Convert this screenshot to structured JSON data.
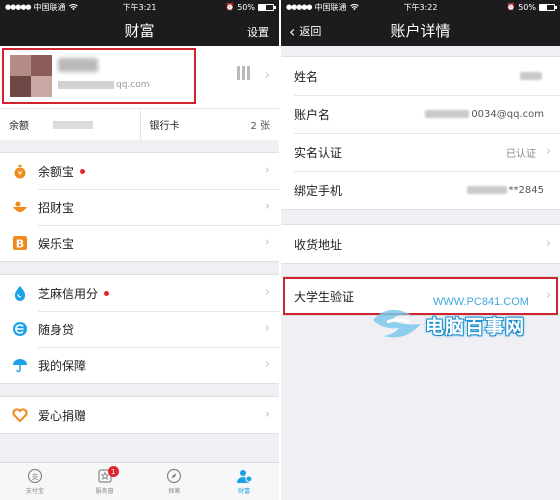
{
  "left": {
    "status": {
      "carrier": "中国联通",
      "time": "下午3:21",
      "battery": "50%",
      "battery_level": 0.5
    },
    "nav": {
      "title": "财富",
      "settings": "设置"
    },
    "profile": {
      "email_suffix": "qq.com"
    },
    "balance": {
      "label": "余额",
      "bank_label": "银行卡",
      "bank_count": "2 张"
    },
    "groups": [
      [
        {
          "label": "余额宝",
          "icon": "money-bag-icon",
          "dot": true
        },
        {
          "label": "招财宝",
          "icon": "fortune-bowl-icon",
          "dot": false
        },
        {
          "label": "娱乐宝",
          "icon": "b-logo-icon",
          "dot": false
        }
      ],
      [
        {
          "label": "芝麻信用分",
          "icon": "water-drop-icon",
          "dot": true
        },
        {
          "label": "随身贷",
          "icon": "e-logo-icon",
          "dot": false
        },
        {
          "label": "我的保障",
          "icon": "umbrella-icon",
          "dot": false
        }
      ],
      [
        {
          "label": "爱心捐赠",
          "icon": "heart-icon",
          "dot": false
        }
      ]
    ],
    "tabs": [
      {
        "label": "支付宝",
        "icon": "alipay-icon",
        "active": false
      },
      {
        "label": "服务窗",
        "icon": "star-window-icon",
        "active": false,
        "badge": "1"
      },
      {
        "label": "探索",
        "icon": "compass-icon",
        "active": false
      },
      {
        "label": "财富",
        "icon": "wealth-user-icon",
        "active": true
      }
    ]
  },
  "right": {
    "status": {
      "carrier": "中国联通",
      "time": "下午3:22",
      "battery": "50%",
      "battery_level": 0.5
    },
    "nav": {
      "back": "返回",
      "title": "账户详情"
    },
    "rows": [
      {
        "label": "姓名",
        "value": ""
      },
      {
        "label": "账户名",
        "value": "0034@qq.com"
      },
      {
        "label": "实名认证",
        "value": "已认证"
      },
      {
        "label": "绑定手机",
        "value": "**2845"
      }
    ],
    "address": {
      "label": "收货地址"
    },
    "student": {
      "label": "大学生验证"
    }
  },
  "watermark": {
    "url": "WWW.PC841.COM",
    "text": "电脑百事网"
  },
  "colors": {
    "nav_bg": "#1c1c1e",
    "highlight": "#d0252f",
    "accent": "#1aa1e6",
    "alert": "#e0262f"
  }
}
